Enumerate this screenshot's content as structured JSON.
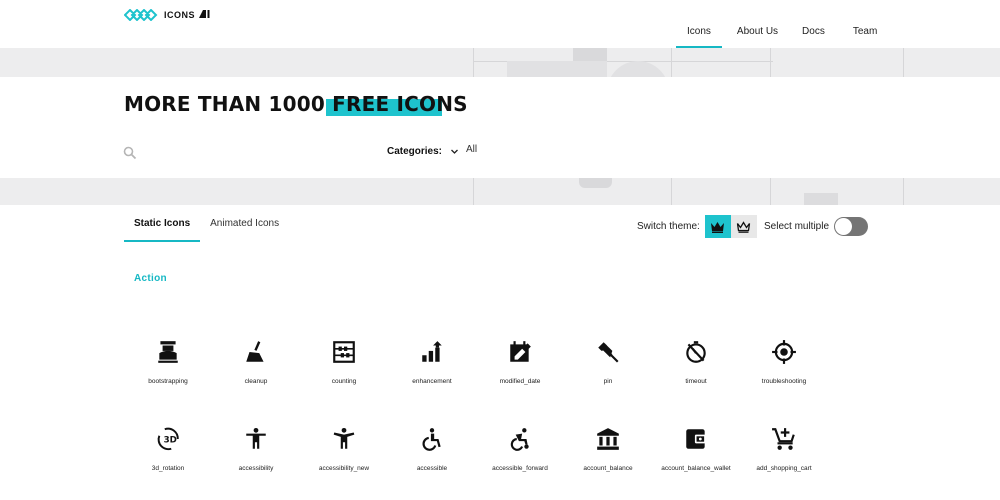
{
  "header": {
    "logo_text": "ICONS",
    "logo_suffix": "AI",
    "nav": [
      "Icons",
      "About Us",
      "Docs",
      "Team"
    ],
    "active_nav": "Icons",
    "brand_color": "#1ec3cd"
  },
  "hero": {
    "title": "MORE THAN 1000 FREE ICONS",
    "categories_label": "Categories:",
    "categories_value": "All"
  },
  "tabs": {
    "items": [
      "Static Icons",
      "Animated Icons"
    ],
    "active": "Static Icons"
  },
  "controls": {
    "switch_theme_label": "Switch theme:",
    "select_multiple_label": "Select multiple",
    "select_multiple_on": false
  },
  "section": {
    "title": "Action"
  },
  "icons": [
    {
      "name": "bootstrapping",
      "icon": "bootstrapping-icon"
    },
    {
      "name": "cleanup",
      "icon": "cleanup-icon"
    },
    {
      "name": "counting",
      "icon": "counting-icon"
    },
    {
      "name": "enhancement",
      "icon": "enhancement-icon"
    },
    {
      "name": "modified_date",
      "icon": "modified-date-icon"
    },
    {
      "name": "pin",
      "icon": "pin-icon"
    },
    {
      "name": "timeout",
      "icon": "timeout-icon"
    },
    {
      "name": "troubleshooting",
      "icon": "troubleshooting-icon"
    },
    {
      "name": "3d_rotation",
      "icon": "3d-rotation-icon"
    },
    {
      "name": "accessibility",
      "icon": "accessibility-icon"
    },
    {
      "name": "accessibility_new",
      "icon": "accessibility-new-icon"
    },
    {
      "name": "accessible",
      "icon": "accessible-icon"
    },
    {
      "name": "accessible_forward",
      "icon": "accessible-forward-icon"
    },
    {
      "name": "account_balance",
      "icon": "account-balance-icon"
    },
    {
      "name": "account_balance_wallet",
      "icon": "account-balance-wallet-icon"
    },
    {
      "name": "add_shopping_cart",
      "icon": "add-shopping-cart-icon"
    }
  ]
}
